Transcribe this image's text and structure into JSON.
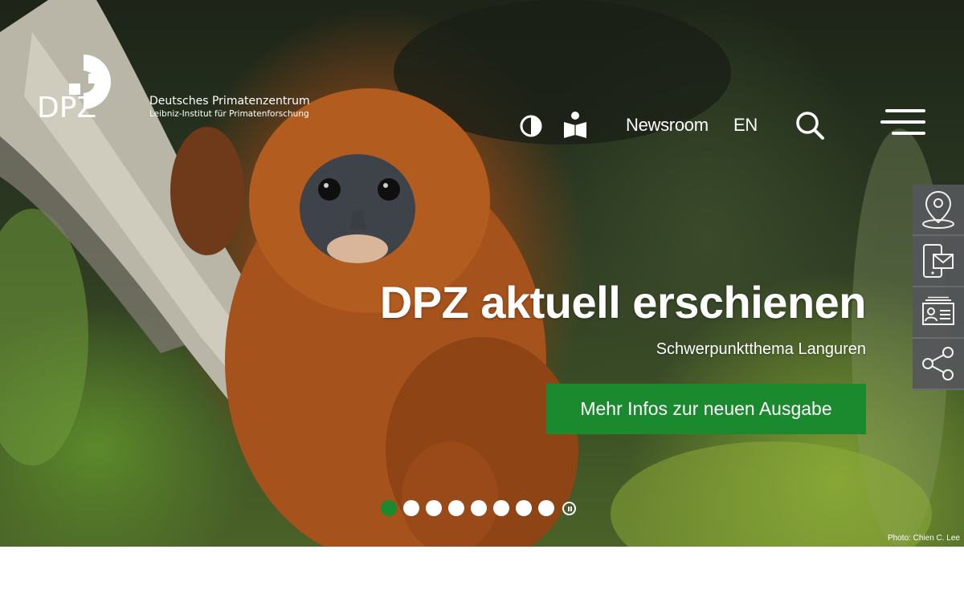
{
  "brand": {
    "logo_text": "DPZ",
    "name": "Deutsches Primatenzentrum",
    "tagline": "Leibniz-Institut für Primatenforschung"
  },
  "nav": {
    "contrast_icon": "contrast-icon",
    "reader_icon": "easy-read-book-icon",
    "newsroom": "Newsroom",
    "language": "EN",
    "search_icon": "search-icon",
    "menu_icon": "hamburger-menu-icon"
  },
  "hero": {
    "headline": "DPZ aktuell erschienen",
    "subline": "Schwerpunktthema Languren",
    "cta": "Mehr Infos zur neuen Ausgabe",
    "photo_credit": "Photo: Chien C. Lee",
    "slides_total": 8,
    "active_slide": 1
  },
  "side_toolbar": [
    {
      "icon": "location-pin-icon",
      "label": ""
    },
    {
      "icon": "mobile-mail-icon",
      "label": ""
    },
    {
      "icon": "contact-card-icon",
      "label": ""
    },
    {
      "icon": "share-icon",
      "label": ""
    }
  ],
  "colors": {
    "accent_green": "#1b8a2e",
    "side_toolbar_bg": "#55575a"
  }
}
